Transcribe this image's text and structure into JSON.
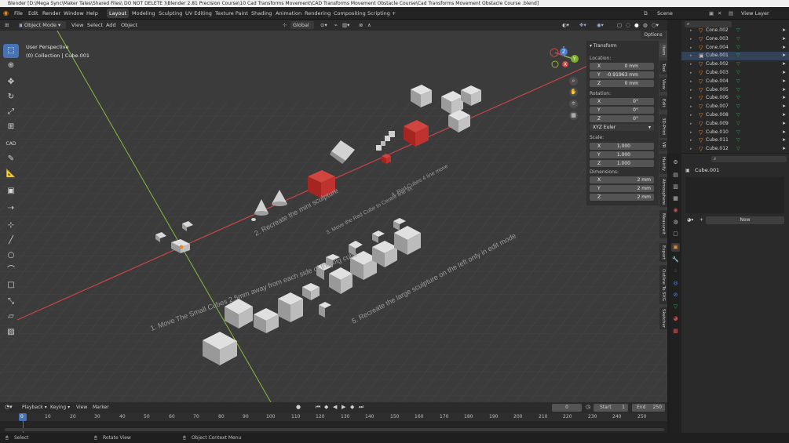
{
  "title_bar": "Blender [D:\\Mega Sync\\Maker Tales\\Shared Files\\ DO NOT DELETE )\\Blender 2.81 Precision Course\\10 Cad Transforms Movement\\CAD Transforms Movement Obstacle Course\\Cad Transforms Movement Obstacle Course .blend]",
  "menu": [
    "File",
    "Edit",
    "Render",
    "Window",
    "Help"
  ],
  "workspaces": [
    {
      "label": "Layout",
      "active": true
    },
    {
      "label": "Modeling"
    },
    {
      "label": "Sculpting"
    },
    {
      "label": "UV Editing"
    },
    {
      "label": "Texture Paint"
    },
    {
      "label": "Shading"
    },
    {
      "label": "Animation"
    },
    {
      "label": "Rendering"
    },
    {
      "label": "Compositing"
    },
    {
      "label": "Scripting"
    }
  ],
  "add_workspace": "+",
  "scene_label": "Scene",
  "view_layer_label": "View Layer",
  "viewport_header": {
    "mode": "Object Mode",
    "menus": [
      "View",
      "Select",
      "Add",
      "Object"
    ],
    "orientation": "Global",
    "options": "Options"
  },
  "hud": {
    "view": "User Perspective",
    "collection": "(0) Collection | Cube.001"
  },
  "scene_text": [
    "1. Move The Small Cubes 2.5mm away from each side of the big cube",
    "2. Recreate the mini sculpture",
    "3. Move the Red Cube to Centre line 3x",
    "4. Red Cubes 4 line move",
    "5. Recreate the large sculpture on the left only in edit mode"
  ],
  "transform_panel": {
    "title": "Transform",
    "location_label": "Location:",
    "location": [
      {
        "axis": "X",
        "value": "0 mm"
      },
      {
        "axis": "Y",
        "value": "-0.91963 mm"
      },
      {
        "axis": "Z",
        "value": "0 mm"
      }
    ],
    "rotation_label": "Rotation:",
    "rotation": [
      {
        "axis": "X",
        "value": "0°"
      },
      {
        "axis": "Y",
        "value": "0°"
      },
      {
        "axis": "Z",
        "value": "0°"
      }
    ],
    "rotation_mode": "XYZ Euler",
    "scale_label": "Scale:",
    "scale": [
      {
        "axis": "X",
        "value": "1.000"
      },
      {
        "axis": "Y",
        "value": "1.000"
      },
      {
        "axis": "Z",
        "value": "1.000"
      }
    ],
    "dimensions_label": "Dimensions:",
    "dimensions": [
      {
        "axis": "X",
        "value": "2 mm"
      },
      {
        "axis": "Y",
        "value": "2 mm"
      },
      {
        "axis": "Z",
        "value": "2 mm"
      }
    ]
  },
  "sidebar_tabs": [
    "Item",
    "Tool",
    "View",
    "Edit",
    "3D-Print",
    "VR",
    "Hairify",
    "Atmosphere",
    "Measureit",
    "Export",
    "Outline To SVG",
    "Sketcher"
  ],
  "outliner_rows": [
    "Cone.002",
    "Cone.003",
    "Cone.004",
    "Cube.001",
    "Cube.002",
    "Cube.003",
    "Cube.004",
    "Cube.005",
    "Cube.006",
    "Cube.007",
    "Cube.008",
    "Cube.009",
    "Cube.010",
    "Cube.011",
    "Cube.012"
  ],
  "properties": {
    "object_name": "Cube.001",
    "new_label": "New"
  },
  "timeline": {
    "menus": [
      "Playback",
      "Keying",
      "View",
      "Marker"
    ],
    "current_frame": "0",
    "start_label": "Start",
    "start": "1",
    "end_label": "End",
    "end": "250",
    "frames": [
      "0",
      "10",
      "20",
      "30",
      "40",
      "50",
      "60",
      "70",
      "80",
      "90",
      "100",
      "110",
      "120",
      "130",
      "140",
      "150",
      "160",
      "170",
      "180",
      "190",
      "200",
      "210",
      "220",
      "230",
      "240",
      "250"
    ]
  },
  "status_bar": {
    "select": "Select",
    "rotate": "Rotate View",
    "context": "Object Context Menu"
  },
  "colors": {
    "accent": "#4772b3",
    "red_cube": "#c0322d",
    "x_axis": "#c8454a",
    "y_axis": "#8cb83c",
    "active_frame": "#4772b3"
  }
}
